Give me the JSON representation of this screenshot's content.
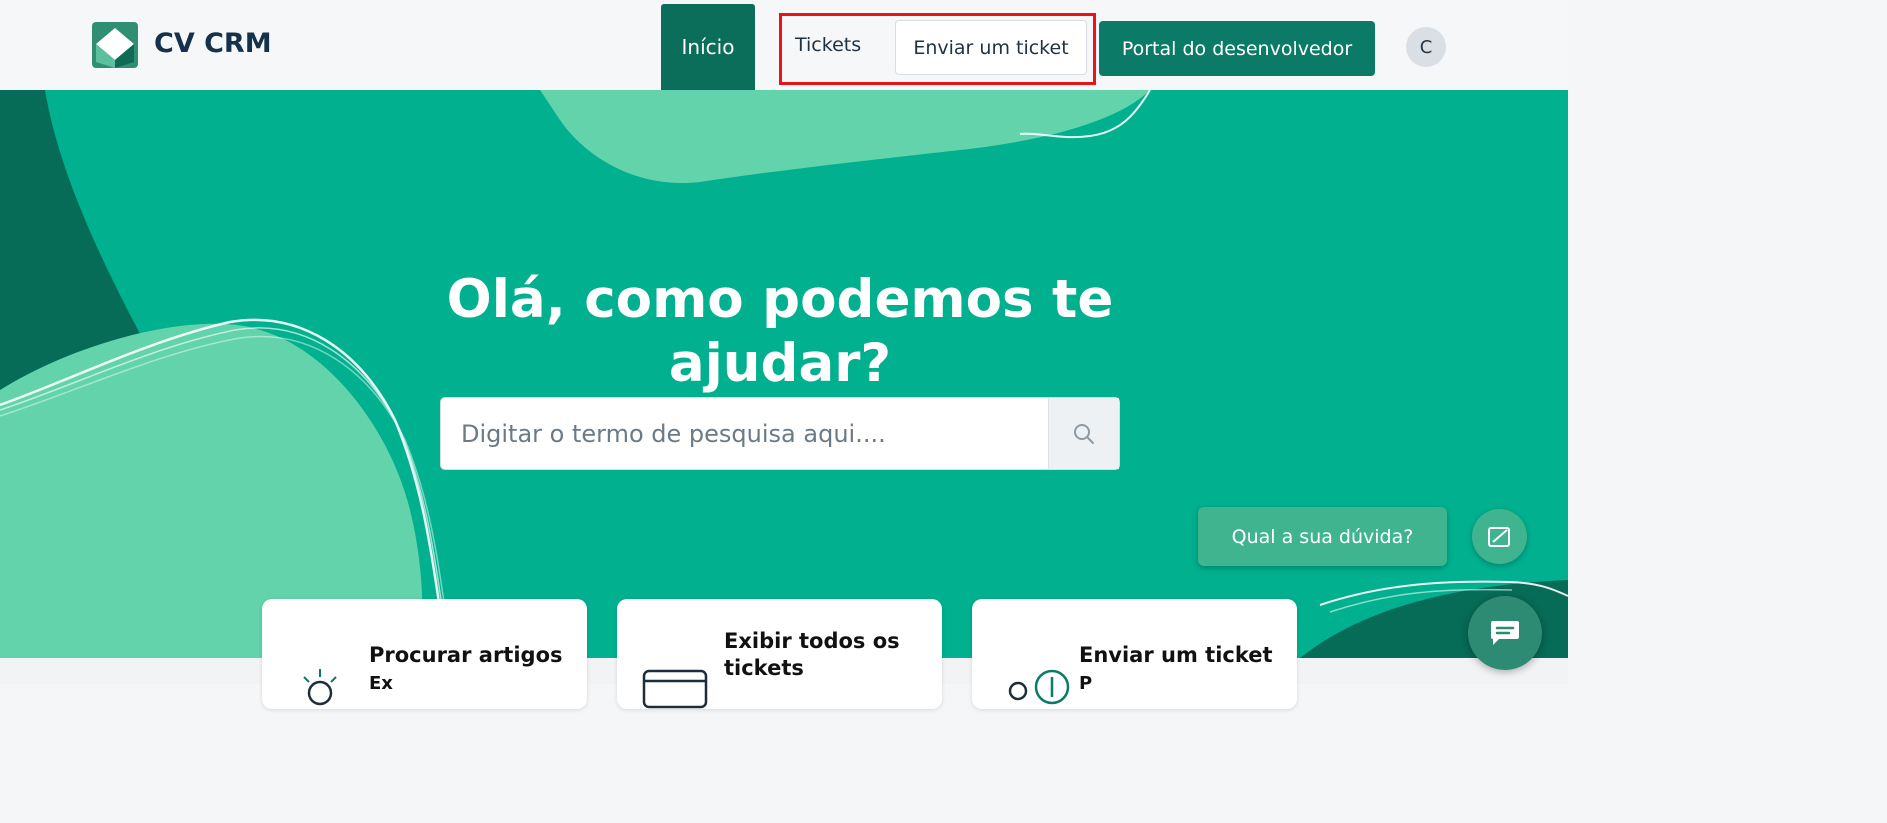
{
  "header": {
    "brand": "CV CRM",
    "nav": {
      "home": "Início",
      "tickets": "Tickets",
      "submit_ticket": "Enviar um ticket",
      "developer_portal": "Portal do desenvolvedor"
    },
    "avatar_initial": "C"
  },
  "hero": {
    "headline": "Olá, como podemos te ajudar?",
    "search_placeholder": "Digitar o termo de pesquisa aqui...."
  },
  "help_widget": {
    "label": "Qual a sua dúvida?"
  },
  "cards": [
    {
      "title": "Procurar artigos",
      "sub": "Ex"
    },
    {
      "title": "Exibir todos os tickets",
      "sub": ""
    },
    {
      "title": "Enviar um ticket",
      "sub": "P"
    }
  ],
  "colors": {
    "brand_green": "#0b7a66",
    "hero_green": "#00b08f",
    "highlight_red": "#e8141a"
  }
}
